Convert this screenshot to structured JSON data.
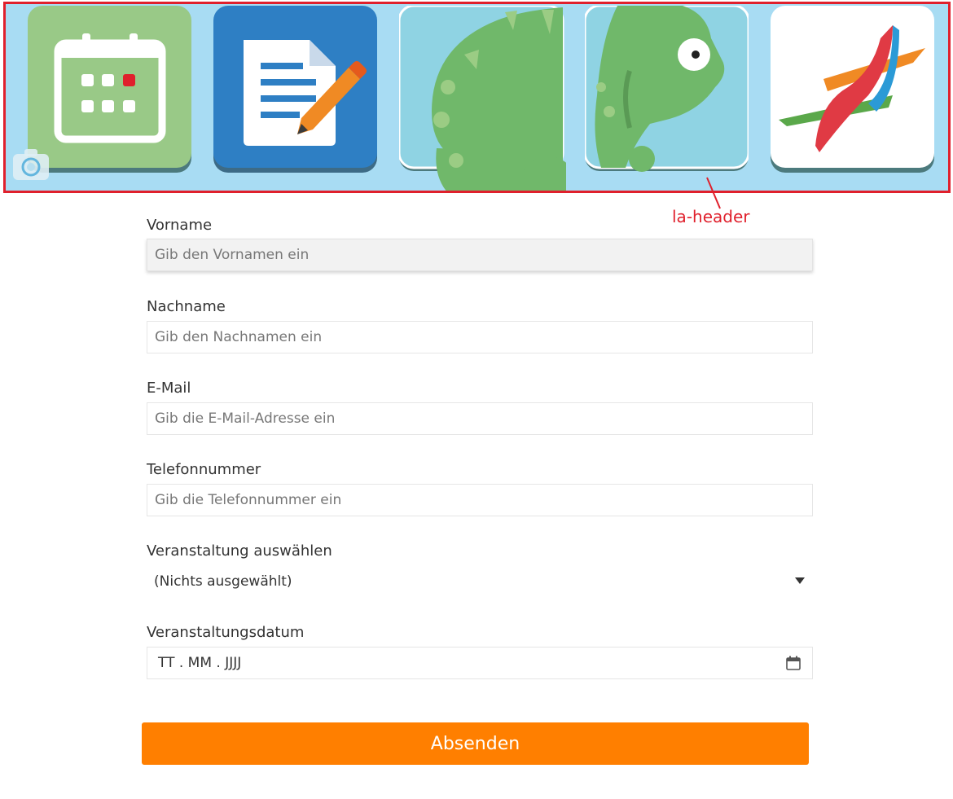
{
  "header": {
    "annotation_label": "la-header",
    "tiles": [
      {
        "icon": "calendar-icon",
        "color": "#99c987"
      },
      {
        "icon": "document-pencil-icon",
        "color": "#2e7fc4"
      },
      {
        "icon": "chameleon-body-icon",
        "color": "#8fd3e3"
      },
      {
        "icon": "chameleon-head-icon",
        "color": "#8fd3e3"
      },
      {
        "icon": "dna-ribbon-icon",
        "color": "#ffffff"
      }
    ]
  },
  "form": {
    "vorname": {
      "label": "Vorname",
      "placeholder": "Gib den Vornamen ein",
      "value": ""
    },
    "nachname": {
      "label": "Nachname",
      "placeholder": "Gib den Nachnamen ein",
      "value": ""
    },
    "email": {
      "label": "E-Mail",
      "placeholder": "Gib die E-Mail-Adresse ein",
      "value": ""
    },
    "telefon": {
      "label": "Telefonnummer",
      "placeholder": "Gib die Telefonnummer ein",
      "value": ""
    },
    "veranstaltung": {
      "label": "Veranstaltung auswählen",
      "selected": "(Nichts ausgewählt)"
    },
    "datum": {
      "label": "Veranstaltungsdatum",
      "placeholder": "TT . MM . JJJJ"
    },
    "submit_label": "Absenden"
  },
  "colors": {
    "accent": "#ff7f00",
    "annotation": "#e0202c",
    "header_bg": "#a8dcf3"
  }
}
